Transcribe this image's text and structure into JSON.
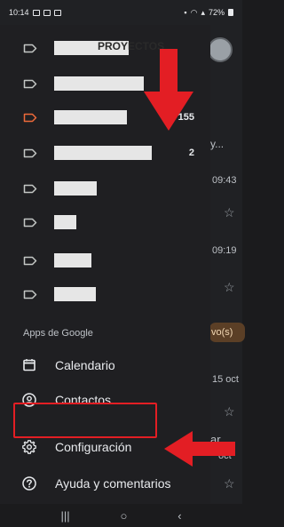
{
  "status_bar": {
    "time": "10:14",
    "battery": "72%"
  },
  "labels": [
    {
      "name": "PROYECTOS",
      "count": "",
      "icon_color": "#c4c7c5",
      "redacted": true
    },
    {
      "name": "",
      "count": "",
      "icon_color": "#c4c7c5",
      "redacted": true
    },
    {
      "name": "",
      "count": "155",
      "icon_color": "#ee6a3a",
      "redacted": true
    },
    {
      "name": "",
      "count": "2",
      "icon_color": "#c4c7c5",
      "redacted": true
    },
    {
      "name": "",
      "count": "",
      "icon_color": "#c4c7c5",
      "redacted": true
    },
    {
      "name": "",
      "count": "",
      "icon_color": "#c4c7c5",
      "redacted": true
    },
    {
      "name": "",
      "count": "",
      "icon_color": "#c4c7c5",
      "redacted": true
    },
    {
      "name": "",
      "count": "",
      "icon_color": "#c4c7c5",
      "redacted": true
    }
  ],
  "google_apps": {
    "title": "Apps de Google",
    "items": [
      {
        "label": "Calendario",
        "icon": "calendar-icon"
      },
      {
        "label": "Contactos",
        "icon": "contacts-icon"
      }
    ]
  },
  "settings": {
    "label": "Configuración",
    "icon": "gear-icon"
  },
  "help": {
    "label": "Ayuda y comentarios",
    "icon": "help-icon"
  },
  "background": {
    "snippets": [
      "y...",
      "09:43",
      "09:19",
      "vo(s)",
      "15 oct",
      "ar",
      "oct"
    ]
  },
  "annotation_color": "#e31e24"
}
